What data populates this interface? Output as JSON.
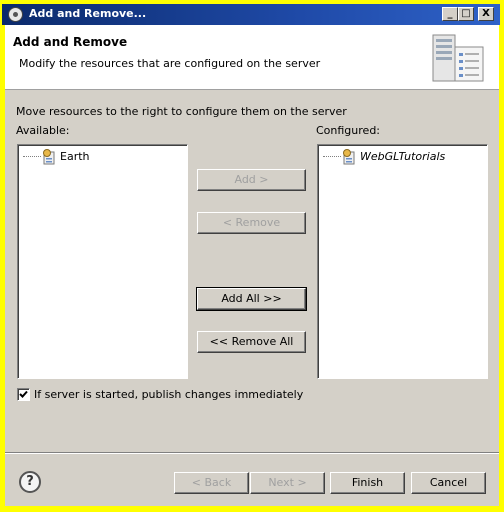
{
  "window": {
    "title": "Add and Remove...",
    "controls": {
      "minimize": "_",
      "maximize": "□",
      "close": "X"
    }
  },
  "banner": {
    "title": "Add and Remove",
    "description": "Modify the resources that are configured on the server",
    "icon": "server-config-icon"
  },
  "instructions": "Move resources to the right to configure them on the server",
  "available": {
    "label": "Available:",
    "items": [
      {
        "label": "Earth",
        "icon": "web-module-icon"
      }
    ]
  },
  "configured": {
    "label": "Configured:",
    "items": [
      {
        "label": "WebGLTutorials",
        "icon": "web-module-icon"
      }
    ]
  },
  "buttons": {
    "add": "Add >",
    "remove": "< Remove",
    "add_all": "Add All >>",
    "remove_all": "<< Remove All"
  },
  "publish_checkbox": {
    "label": "If server is started, publish changes immediately",
    "checked": true
  },
  "footer": {
    "help": "?",
    "back": "< Back",
    "next": "Next >",
    "finish": "Finish",
    "cancel": "Cancel"
  }
}
